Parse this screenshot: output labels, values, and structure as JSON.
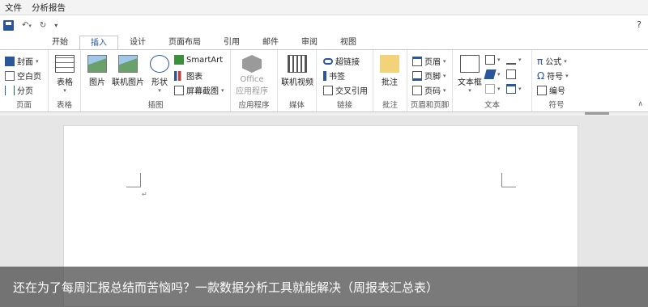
{
  "menubar": {
    "items": [
      "文件",
      "分析报告"
    ]
  },
  "qat": {
    "help": "?"
  },
  "tabs": [
    "开始",
    "插入",
    "设计",
    "页面布局",
    "引用",
    "邮件",
    "审阅",
    "视图"
  ],
  "active_tab": "插入",
  "ribbon": {
    "pages": {
      "label": "页面",
      "cover": "封面",
      "blank": "空白页",
      "break": "分页"
    },
    "table": {
      "label": "表格",
      "button": "表格"
    },
    "illustrations": {
      "label": "插图",
      "picture": "图片",
      "online_picture": "联机图片",
      "shapes": "形状",
      "smartart": "SmartArt",
      "chart": "图表",
      "screenshot": "屏幕截图"
    },
    "apps": {
      "label": "应用程序",
      "office_top": "Office",
      "office_bottom": "应用程序"
    },
    "media": {
      "label": "媒体",
      "online_video": "联机视频"
    },
    "links": {
      "label": "链接",
      "hyperlink": "超链接",
      "bookmark": "书签",
      "cross_ref": "交叉引用"
    },
    "comments": {
      "label": "批注",
      "comment": "批注"
    },
    "header_footer": {
      "label": "页眉和页脚",
      "header": "页眉",
      "footer": "页脚",
      "page_number": "页码"
    },
    "text": {
      "label": "文本",
      "textbox": "文本框"
    },
    "symbols": {
      "label": "符号",
      "equation": "公式",
      "symbol": "符号",
      "number": "编号"
    }
  },
  "document": {
    "para_mark": "↵"
  },
  "banner": {
    "text": "还在为了每周汇报总结而苦恼吗？一款数据分析工具就能解决（周报表汇总表）"
  },
  "colors": {
    "accent": "#2b579a",
    "banner_bg": "#464646"
  }
}
